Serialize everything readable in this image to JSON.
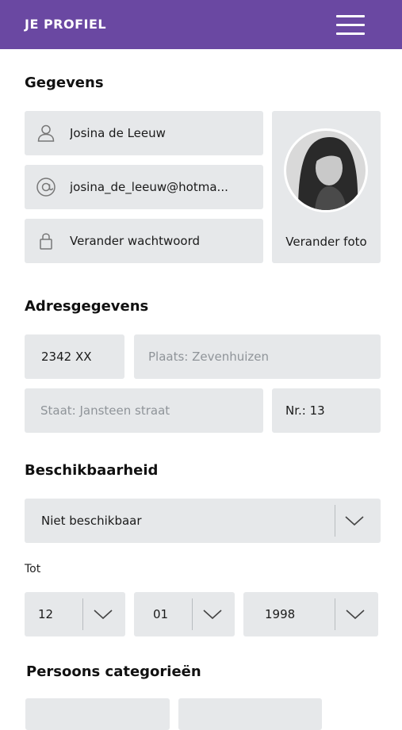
{
  "header": {
    "title": "JE PROFIEL"
  },
  "gegevens": {
    "heading": "Gegevens",
    "name": "Josina de Leeuw",
    "email": "josina_de_leeuw@hotma...",
    "password_label": "Verander wachtwoord",
    "photo_label": "Verander foto"
  },
  "adres": {
    "heading": "Adresgegevens",
    "postcode": "2342 XX",
    "plaats_placeholder": "Plaats: Zevenhuizen",
    "straat_placeholder": "Staat: Jansteen straat",
    "nummer": "Nr.: 13"
  },
  "beschikbaarheid": {
    "heading": "Beschikbaarheid",
    "selected": "Niet beschikbaar",
    "tot_label": "Tot",
    "day": "12",
    "month": "01",
    "year": "1998"
  },
  "categorieen": {
    "heading": "Persoons categorieën"
  },
  "icons": [
    "user-icon",
    "at-icon",
    "lock-icon",
    "chevron-down-icon"
  ],
  "colors": {
    "header": "#6a48a2",
    "field_bg": "#e6e8ea",
    "placeholder": "#8f9499"
  }
}
